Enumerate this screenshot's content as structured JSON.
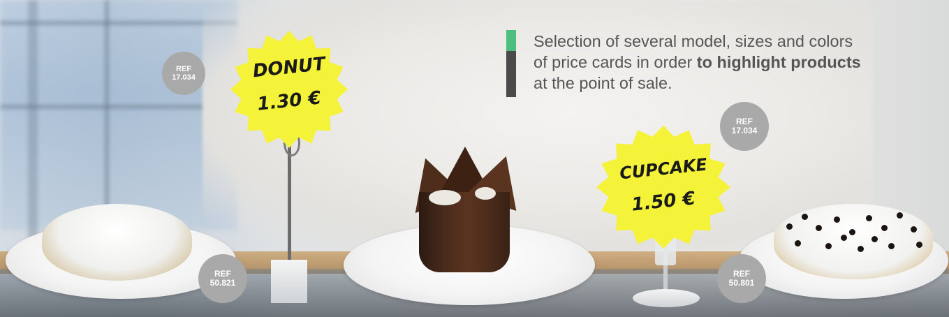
{
  "headline": {
    "line1": "Selection of several model, sizes and colors",
    "line2_before": "of price cards in order ",
    "line2_bold": "to highlight products",
    "line3": "at the point of sale."
  },
  "price_cards": [
    {
      "product": "DONUT",
      "price": "1.30 €"
    },
    {
      "product": "CUPCAKE",
      "price": "1.50 €"
    }
  ],
  "ref_badges": [
    {
      "label": "REF",
      "code": "17.034"
    },
    {
      "label": "REF",
      "code": "17.034"
    },
    {
      "label": "REF",
      "code": "50.821"
    },
    {
      "label": "REF",
      "code": "50.801"
    }
  ],
  "colors": {
    "accent_green": "#4fbf7f",
    "accent_dark": "#4a4a4a",
    "card_yellow": "#f5f23a",
    "badge_gray": "#a9a9a9"
  }
}
